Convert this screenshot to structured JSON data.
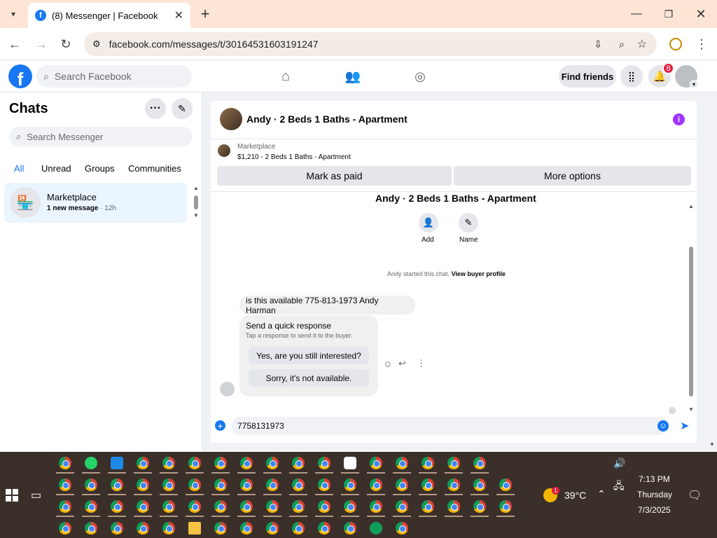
{
  "browser": {
    "tab_title": "(8) Messenger | Facebook",
    "url": "facebook.com/messages/t/30164531603191247"
  },
  "fb_header": {
    "search_placeholder": "Search Facebook",
    "find_friends": "Find friends",
    "notification_count": "8"
  },
  "sidebar": {
    "title": "Chats",
    "search_placeholder": "Search Messenger",
    "filters": [
      "All",
      "Unread",
      "Groups",
      "Communities"
    ],
    "conversation": {
      "name": "Marketplace",
      "preview": "1 new message",
      "time": "· 12h"
    }
  },
  "chat": {
    "title": "Andy · 2 Beds 1 Baths - Apartment",
    "listing_source": "Marketplace",
    "listing_price": "$1,210 - 2 Beds 1 Baths - Apartment",
    "mark_paid": "Mark as paid",
    "more_options": "More options",
    "thread_title": "Andy · 2 Beds 1 Baths - Apartment",
    "add_label": "Add",
    "name_label": "Name",
    "started_text": "Andy started this chat.",
    "buyer_profile_link": "View buyer profile",
    "message": "is this available 775-813-1973 Andy Harman",
    "quick_title": "Send a quick response",
    "quick_sub": "Tap a response to send it to the buyer.",
    "quick_yes": "Yes, are you still interested?",
    "quick_no": "Sorry, it's not available.",
    "composer_value": "7758131973"
  },
  "taskbar": {
    "weather_temp": "39°C",
    "weather_badge": "1",
    "time": "7:13 PM",
    "day": "Thursday",
    "date": "7/3/2025"
  },
  "colors": {
    "facebook_blue": "#1877f2",
    "tab_bar": "#fde5d6",
    "notification_red": "#e41e3f",
    "info_purple": "#a033ff"
  }
}
